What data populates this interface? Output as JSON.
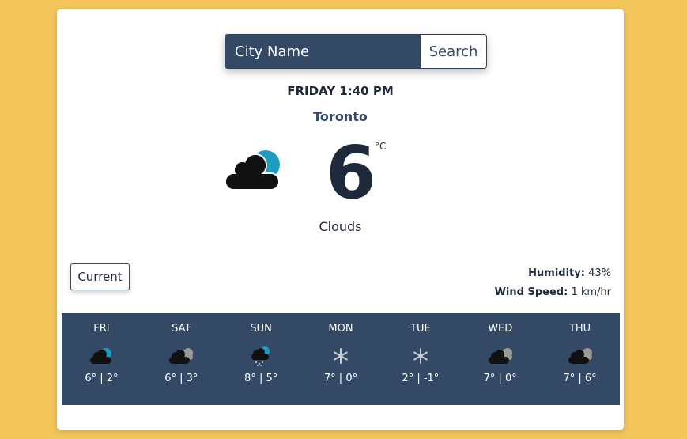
{
  "search": {
    "placeholder": "City Name",
    "button_label": "Search"
  },
  "current": {
    "datetime": "FRIDAY 1:40 PM",
    "city": "Toronto",
    "temperature": "6",
    "unit": "°C",
    "description": "Clouds",
    "icon": "cloud-sun-icon"
  },
  "current_button": "Current",
  "stats": {
    "humidity_label": "Humidity:",
    "humidity_value": "43%",
    "wind_label": "Wind Speed:",
    "wind_value": "1 km/hr"
  },
  "colors": {
    "background": "#f2c65a",
    "accent": "#344966",
    "sun": "#1e9bc0"
  },
  "forecast": [
    {
      "day": "FRI",
      "temps": "6° | 2°",
      "icon": "cloud-sun-icon"
    },
    {
      "day": "SAT",
      "temps": "6° | 3°",
      "icon": "clouds-icon"
    },
    {
      "day": "SUN",
      "temps": "8° | 5°",
      "icon": "cloud-sun-rain-icon"
    },
    {
      "day": "MON",
      "temps": "7° | 0°",
      "icon": "snowflake-icon"
    },
    {
      "day": "TUE",
      "temps": "2° | -1°",
      "icon": "snowflake-icon"
    },
    {
      "day": "WED",
      "temps": "7° | 0°",
      "icon": "clouds-icon"
    },
    {
      "day": "THU",
      "temps": "7° | 6°",
      "icon": "clouds-icon"
    }
  ]
}
